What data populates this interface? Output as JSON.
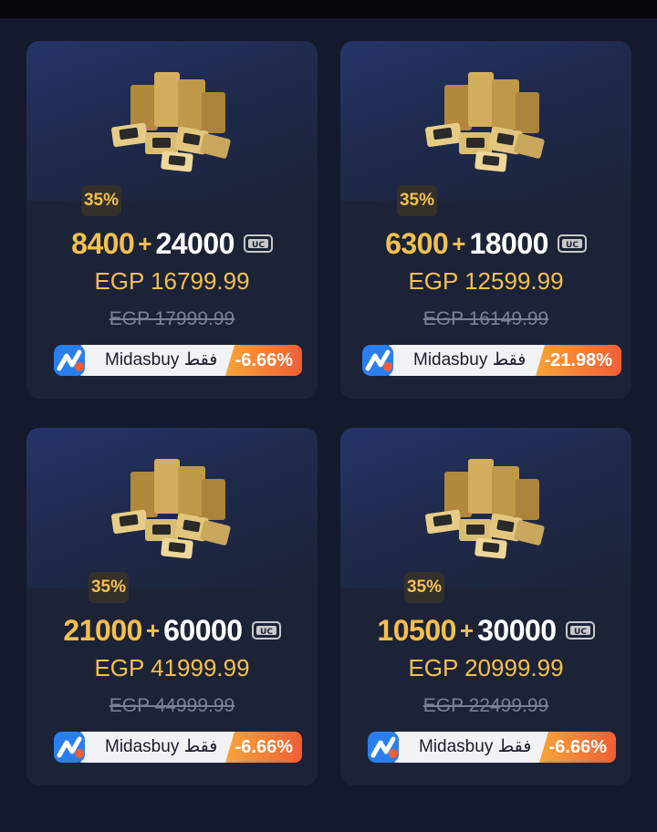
{
  "cards": [
    {
      "bonus_pct": "35%",
      "base": "8400",
      "plus": "+",
      "bonus": "24000",
      "price": "EGP 16799.99",
      "old_price": "EGP 17999.99",
      "promo_text": "Midasbuy فقط",
      "discount": "-6.66%"
    },
    {
      "bonus_pct": "35%",
      "base": "6300",
      "plus": "+",
      "bonus": "18000",
      "price": "EGP 12599.99",
      "old_price": "EGP 16149.99",
      "promo_text": "Midasbuy فقط",
      "discount": "-21.98%"
    },
    {
      "bonus_pct": "35%",
      "base": "21000",
      "plus": "+",
      "bonus": "60000",
      "price": "EGP 41999.99",
      "old_price": "EGP 44999.99",
      "promo_text": "Midasbuy فقط",
      "discount": "-6.66%"
    },
    {
      "bonus_pct": "35%",
      "base": "10500",
      "plus": "+",
      "bonus": "30000",
      "price": "EGP 20999.99",
      "old_price": "EGP 22499.99",
      "promo_text": "Midasbuy فقط",
      "discount": "-6.66%"
    }
  ],
  "icons": {
    "currency": "uc-icon",
    "product": "uc-coin-stack-icon",
    "brand": "midasbuy-logo"
  },
  "colors": {
    "background": "#141a2b",
    "card": "#1c2337",
    "gold": "#f4c04e",
    "discount": "#f15e35"
  }
}
